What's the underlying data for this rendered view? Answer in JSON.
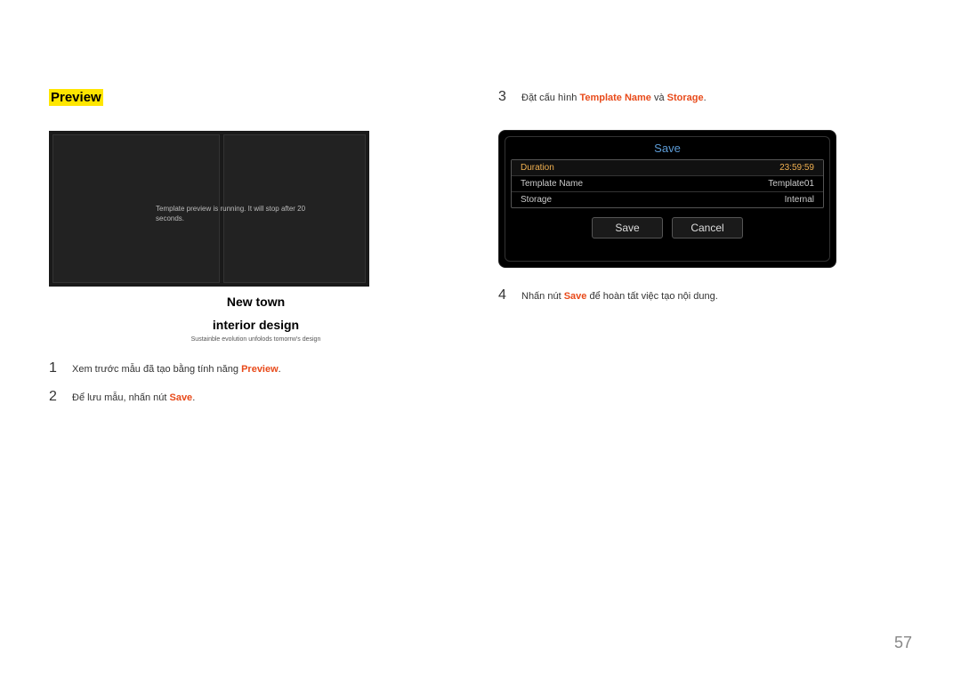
{
  "heading": "Preview",
  "preview_message": "Template preview is running. It will stop after 20 seconds.",
  "caption_line1": "New town",
  "caption_line2": "interior design",
  "subcaption": "Sustainble evolution unfolods tomorrw's design",
  "steps_left": [
    {
      "num": "1",
      "pre": "Xem trước mẫu đã tạo bằng tính năng ",
      "hl": "Preview",
      "post": "."
    },
    {
      "num": "2",
      "pre": "Để lưu mẫu, nhấn nút ",
      "hl": "Save",
      "post": "."
    }
  ],
  "steps_right": [
    {
      "num": "3",
      "pre": "Đặt cấu hình ",
      "hl": "Template Name",
      "mid": " và ",
      "hl2": "Storage",
      "post": "."
    },
    {
      "num": "4",
      "pre": "Nhấn nút ",
      "hl": "Save",
      "post": " để hoàn tất việc tạo nội dung."
    }
  ],
  "dialog": {
    "title": "Save",
    "rows": [
      {
        "label": "Duration",
        "value": "23:59:59",
        "active": true
      },
      {
        "label": "Template Name",
        "value": "Template01",
        "active": false
      },
      {
        "label": "Storage",
        "value": "Internal",
        "active": false
      }
    ],
    "buttons": {
      "save": "Save",
      "cancel": "Cancel"
    }
  },
  "page_number": "57"
}
